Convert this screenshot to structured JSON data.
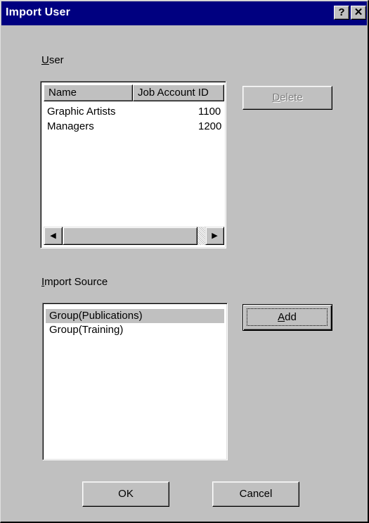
{
  "window": {
    "title": "Import User",
    "help_label": "?",
    "close_label": "✕"
  },
  "user_section": {
    "label": "User",
    "columns": [
      "Name",
      "Job Account ID"
    ],
    "rows": [
      {
        "name": "Graphic Artists",
        "id": "1100"
      },
      {
        "name": "Managers",
        "id": "1200"
      }
    ],
    "scroll_left": "◀",
    "scroll_right": "▶"
  },
  "delete_button": {
    "label": "Delete",
    "enabled": false
  },
  "import_source": {
    "label": "Import Source",
    "items": [
      "Group(Publications)",
      "Group(Training)"
    ],
    "selected_index": 0
  },
  "add_button": {
    "label": "Add"
  },
  "ok_button": {
    "label": "OK"
  },
  "cancel_button": {
    "label": "Cancel"
  },
  "colors": {
    "face": "#c0c0c0",
    "titlebar": "#000080",
    "disabled_text": "#808080"
  }
}
